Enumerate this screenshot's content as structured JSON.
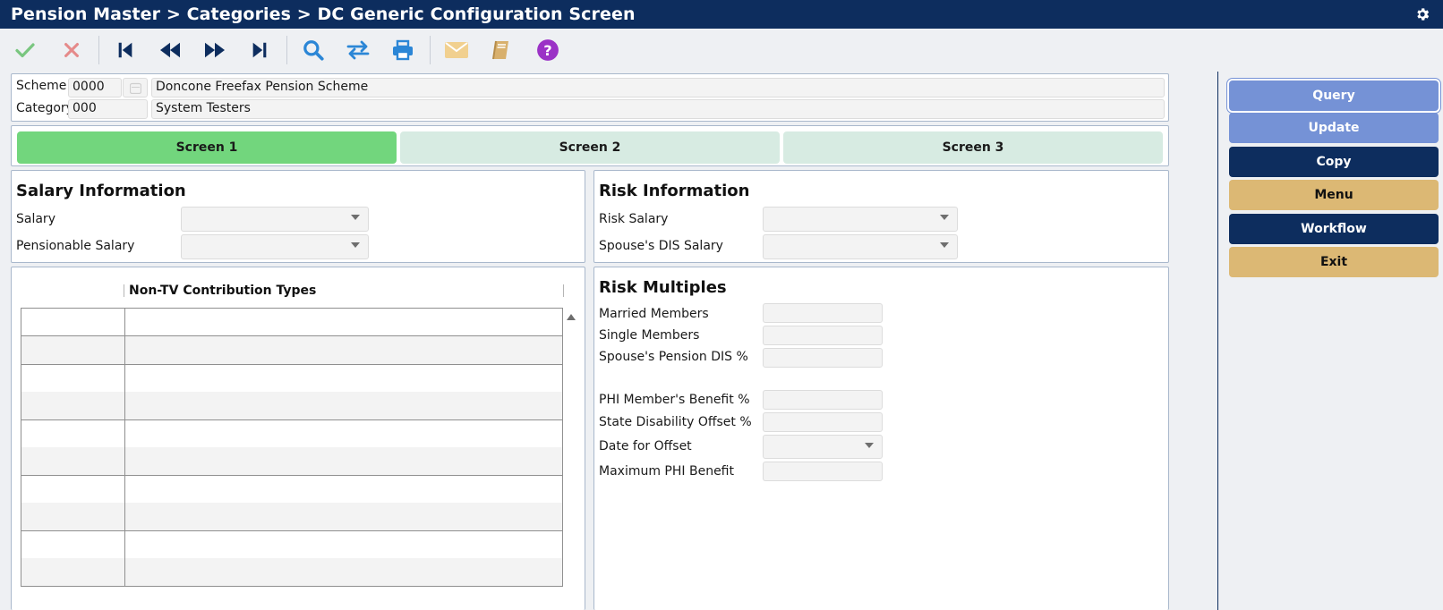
{
  "window": {
    "title": "Pension Master > Categories > DC Generic Configuration Screen",
    "settings_icon": "gear-icon"
  },
  "toolbar": [
    {
      "name": "accept-icon",
      "color": "#79c67f"
    },
    {
      "name": "cancel-icon",
      "color": "#e58a8a"
    },
    {
      "name": "first-record-icon",
      "color": "#0d2d5e"
    },
    {
      "name": "previous-record-icon",
      "color": "#0d2d5e"
    },
    {
      "name": "next-record-icon",
      "color": "#0d2d5e"
    },
    {
      "name": "last-record-icon",
      "color": "#0d2d5e"
    },
    {
      "name": "search-icon",
      "color": "#2b86d6"
    },
    {
      "name": "swap-icon",
      "color": "#2b86d6"
    },
    {
      "name": "print-icon",
      "color": "#2b86d6"
    },
    {
      "name": "mail-icon",
      "color": "#f1d08f"
    },
    {
      "name": "book-icon",
      "color": "#d8b06d"
    },
    {
      "name": "help-icon",
      "color": "#9b32c6"
    }
  ],
  "header": {
    "scheme_label": "Scheme",
    "scheme_code": "0000",
    "scheme_name": "Doncone Freefax Pension Scheme",
    "category_label": "Category",
    "category_code": "000",
    "category_name": "System Testers"
  },
  "tabs": [
    {
      "label": "Screen 1",
      "active": true
    },
    {
      "label": "Screen 2",
      "active": false
    },
    {
      "label": "Screen 3",
      "active": false
    }
  ],
  "salary_info": {
    "title": "Salary Information",
    "salary_label": "Salary",
    "salary_value": "",
    "pensionable_label": "Pensionable Salary",
    "pensionable_value": ""
  },
  "risk_info": {
    "title": "Risk Information",
    "risk_salary_label": "Risk Salary",
    "risk_salary_value": "",
    "spouse_dis_label": "Spouse's DIS Salary",
    "spouse_dis_value": ""
  },
  "contributions": {
    "col1_header": "",
    "col2_header": "Non-TV Contribution Types",
    "rows": [
      [
        "",
        ""
      ],
      [
        "",
        ""
      ],
      [
        "",
        ""
      ],
      [
        "",
        ""
      ],
      [
        "",
        ""
      ],
      [
        "",
        ""
      ],
      [
        "",
        ""
      ],
      [
        "",
        ""
      ],
      [
        "",
        ""
      ],
      [
        "",
        ""
      ]
    ]
  },
  "risk_multiples": {
    "title": "Risk Multiples",
    "married_label": "Married Members",
    "married_value": "",
    "single_label": "Single Members",
    "single_value": "",
    "spouse_pension_label": "Spouse's Pension DIS %",
    "spouse_pension_value": "",
    "phi_label": "PHI Member's Benefit %",
    "phi_value": "",
    "state_label": "State Disability Offset %",
    "state_value": "",
    "date_label": "Date for Offset",
    "date_value": "",
    "max_label": "Maximum PHI Benefit",
    "max_value": ""
  },
  "actions": {
    "query": "Query",
    "update": "Update",
    "copy": "Copy",
    "menu": "Menu",
    "workflow": "Workflow",
    "exit": "Exit"
  },
  "colors": {
    "titlebar": "#0d2d5e",
    "active_tab": "#72d67d",
    "inactive_tab": "#d7ebe2",
    "blue_button": "#7592d6",
    "navy_button": "#0d2d5e",
    "tan_button": "#dcb874"
  }
}
